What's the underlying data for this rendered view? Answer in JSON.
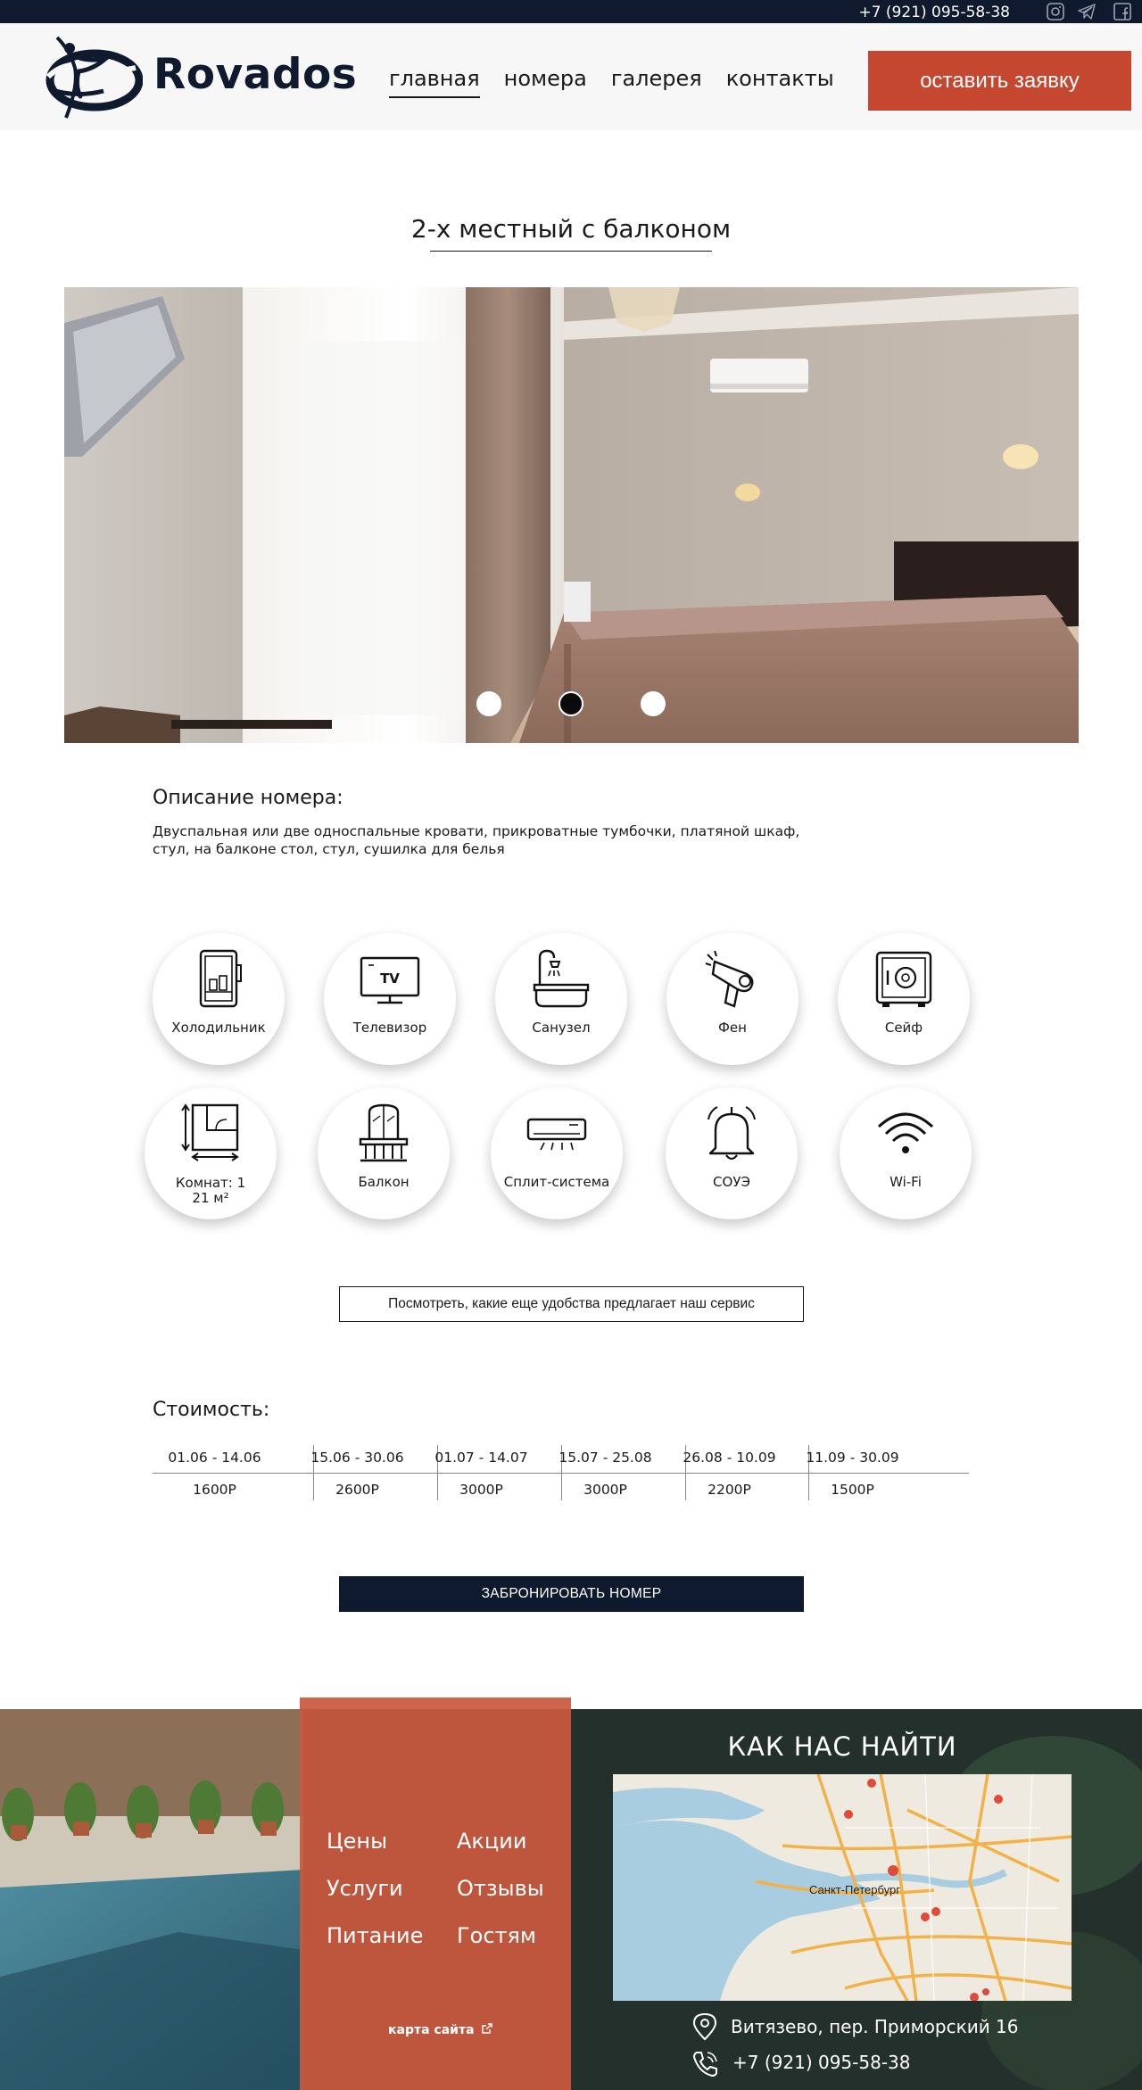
{
  "topbar": {
    "phone": "+7 (921) 095-58-38",
    "social": [
      "instagram-icon",
      "telegram-icon",
      "facebook-icon"
    ]
  },
  "header": {
    "logo_text": "Rovados",
    "nav": [
      {
        "label": "главная",
        "active": true
      },
      {
        "label": "номера",
        "active": false
      },
      {
        "label": "галерея",
        "active": false
      },
      {
        "label": "контакты",
        "active": false
      }
    ],
    "cta_label": "оставить заявку"
  },
  "room": {
    "title": "2-х местный с балконом",
    "slider": {
      "slides": 3,
      "active": 2
    },
    "desc_heading": "Описание номера:",
    "desc_text": "Двуспальная или две односпальные кровати, прикроватные тумбочки, платяной шкаф, стул, на балконе стол, стул, сушилка для белья"
  },
  "amenities": [
    {
      "label": "Холодильник",
      "icon": "fridge-icon"
    },
    {
      "label": "Телевизор",
      "icon": "tv-icon"
    },
    {
      "label": "Санузел",
      "icon": "bathroom-icon"
    },
    {
      "label": "Фен",
      "icon": "hairdryer-icon"
    },
    {
      "label": "Сейф",
      "icon": "safe-icon"
    },
    {
      "label": "Комнат: 1",
      "label2": "21 м²",
      "icon": "room-plan-icon"
    },
    {
      "label": "Балкон",
      "icon": "balcony-icon"
    },
    {
      "label": "Сплит-система",
      "icon": "air-conditioner-icon"
    },
    {
      "label": "СОУЭ",
      "icon": "alarm-bell-icon"
    },
    {
      "label": "Wi-Fi",
      "icon": "wifi-icon"
    }
  ],
  "more_label": "Посмотреть, какие еще удобства предлагает наш сервис",
  "pricing": {
    "heading": "Стоимость:",
    "columns": [
      {
        "period": "01.06 - 14.06",
        "price": "1600Р"
      },
      {
        "period": "15.06 - 30.06",
        "price": "2600Р"
      },
      {
        "period": "01.07 - 14.07",
        "price": "3000Р"
      },
      {
        "period": "15.07 - 25.08",
        "price": "3000Р"
      },
      {
        "period": "26.08 - 10.09",
        "price": "2200Р"
      },
      {
        "period": "11.09 - 30.09",
        "price": "1500Р"
      }
    ]
  },
  "book_label": "ЗАБРОНИРОВАТЬ НОМЕР",
  "footer": {
    "links": [
      "Цены",
      "Акции",
      "Услуги",
      "Отзывы",
      "Питание",
      "Гостям"
    ],
    "sitemap_label": "карта сайта",
    "find_heading": "КАК НАС НАЙТИ",
    "map_city_label": "Санкт-Петербург",
    "address": "Витязево, пер. Приморский 16",
    "phone": "+7 (921) 095-58-38"
  },
  "colors": {
    "navy": "#0f1a2e",
    "accent": "#c6472f",
    "footer_panel": "#c9583e"
  }
}
